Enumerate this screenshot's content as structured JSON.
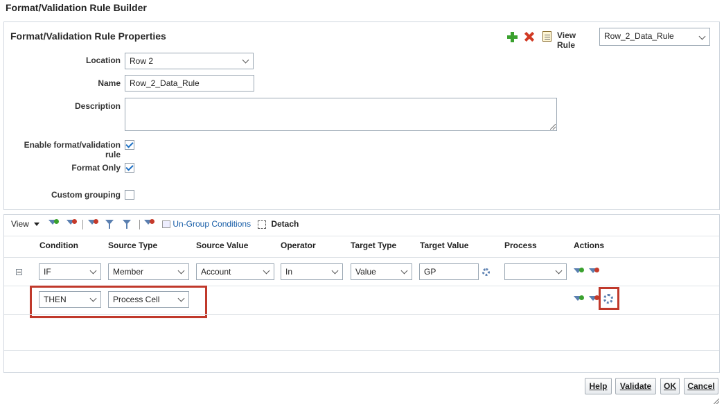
{
  "dialog": {
    "title": "Format/Validation Rule Builder"
  },
  "properties": {
    "title": "Format/Validation Rule Properties",
    "view_rule_label": "View Rule",
    "view_rule_value": "Row_2_Data_Rule",
    "location_label": "Location",
    "location_value": "Row 2",
    "name_label": "Name",
    "name_value": "Row_2_Data_Rule",
    "description_label": "Description",
    "description_value": "",
    "enable_label": "Enable format/validation rule",
    "format_only_label": "Format Only",
    "custom_grouping_label": "Custom grouping"
  },
  "toolbar": {
    "view_label": "View",
    "ungroup_label": "Un-Group Conditions",
    "detach_label": "Detach"
  },
  "table": {
    "columns": [
      "Condition",
      "Source Type",
      "Source Value",
      "Operator",
      "Target Type",
      "Target Value",
      "Process",
      "Actions"
    ],
    "rows": [
      {
        "condition": "IF",
        "source_type": "Member",
        "source_value": "Account",
        "operator": "In",
        "target_type": "Value",
        "target_value": "GP",
        "process": ""
      },
      {
        "condition": "THEN",
        "source_type": "Process Cell"
      }
    ]
  },
  "buttons": {
    "help": "Help",
    "validate": "Validate",
    "ok": "OK",
    "cancel": "Cancel"
  },
  "colors": {
    "accent_link": "#1a5fa8",
    "highlight": "#c0392b",
    "check": "#1b6fc4"
  }
}
